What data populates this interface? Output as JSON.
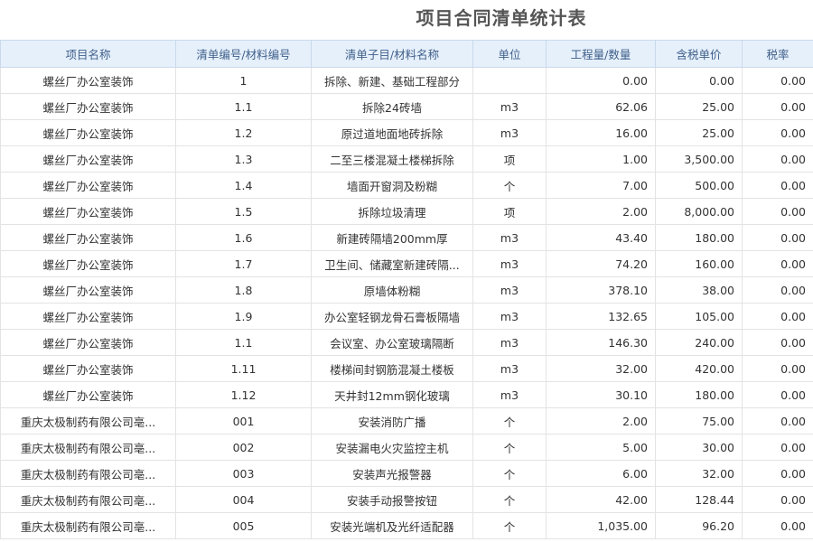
{
  "title": "项目合同清单统计表",
  "columns": [
    "项目名称",
    "清单编号/材料编号",
    "清单子目/材料名称",
    "单位",
    "工程量/数量",
    "含税单价",
    "税率"
  ],
  "rows": [
    {
      "project": "螺丝厂办公室装饰",
      "code": "1",
      "item": "拆除、新建、基础工程部分",
      "unit": "",
      "qty": "0.00",
      "price": "0.00",
      "tax": "0.00"
    },
    {
      "project": "螺丝厂办公室装饰",
      "code": "1.1",
      "item": "拆除24砖墙",
      "unit": "m3",
      "qty": "62.06",
      "price": "25.00",
      "tax": "0.00"
    },
    {
      "project": "螺丝厂办公室装饰",
      "code": "1.2",
      "item": "原过道地面地砖拆除",
      "unit": "m3",
      "qty": "16.00",
      "price": "25.00",
      "tax": "0.00"
    },
    {
      "project": "螺丝厂办公室装饰",
      "code": "1.3",
      "item": "二至三楼混凝土楼梯拆除",
      "unit": "项",
      "qty": "1.00",
      "price": "3,500.00",
      "tax": "0.00"
    },
    {
      "project": "螺丝厂办公室装饰",
      "code": "1.4",
      "item": "墙面开窗洞及粉糊",
      "unit": "个",
      "qty": "7.00",
      "price": "500.00",
      "tax": "0.00"
    },
    {
      "project": "螺丝厂办公室装饰",
      "code": "1.5",
      "item": "拆除垃圾清理",
      "unit": "项",
      "qty": "2.00",
      "price": "8,000.00",
      "tax": "0.00"
    },
    {
      "project": "螺丝厂办公室装饰",
      "code": "1.6",
      "item": "新建砖隔墙200mm厚",
      "unit": "m3",
      "qty": "43.40",
      "price": "180.00",
      "tax": "0.00"
    },
    {
      "project": "螺丝厂办公室装饰",
      "code": "1.7",
      "item": "卫生间、储藏室新建砖隔...",
      "unit": "m3",
      "qty": "74.20",
      "price": "160.00",
      "tax": "0.00"
    },
    {
      "project": "螺丝厂办公室装饰",
      "code": "1.8",
      "item": "原墙体粉糊",
      "unit": "m3",
      "qty": "378.10",
      "price": "38.00",
      "tax": "0.00"
    },
    {
      "project": "螺丝厂办公室装饰",
      "code": "1.9",
      "item": "办公室轻钢龙骨石膏板隔墙",
      "unit": "m3",
      "qty": "132.65",
      "price": "105.00",
      "tax": "0.00"
    },
    {
      "project": "螺丝厂办公室装饰",
      "code": "1.1",
      "item": "会议室、办公室玻璃隔断",
      "unit": "m3",
      "qty": "146.30",
      "price": "240.00",
      "tax": "0.00"
    },
    {
      "project": "螺丝厂办公室装饰",
      "code": "1.11",
      "item": "楼梯间封钢筋混凝土楼板",
      "unit": "m3",
      "qty": "32.00",
      "price": "420.00",
      "tax": "0.00"
    },
    {
      "project": "螺丝厂办公室装饰",
      "code": "1.12",
      "item": "天井封12mm钢化玻璃",
      "unit": "m3",
      "qty": "30.10",
      "price": "180.00",
      "tax": "0.00"
    },
    {
      "project": "重庆太极制药有限公司亳...",
      "code": "001",
      "item": "安装消防广播",
      "unit": "个",
      "qty": "2.00",
      "price": "75.00",
      "tax": "0.00"
    },
    {
      "project": "重庆太极制药有限公司亳...",
      "code": "002",
      "item": "安装漏电火灾监控主机",
      "unit": "个",
      "qty": "5.00",
      "price": "30.00",
      "tax": "0.00"
    },
    {
      "project": "重庆太极制药有限公司亳...",
      "code": "003",
      "item": "安装声光报警器",
      "unit": "个",
      "qty": "6.00",
      "price": "32.00",
      "tax": "0.00"
    },
    {
      "project": "重庆太极制药有限公司亳...",
      "code": "004",
      "item": "安装手动报警按钮",
      "unit": "个",
      "qty": "42.00",
      "price": "128.44",
      "tax": "0.00"
    },
    {
      "project": "重庆太极制药有限公司亳...",
      "code": "005",
      "item": "安装光端机及光纤适配器",
      "unit": "个",
      "qty": "1,035.00",
      "price": "96.20",
      "tax": "0.00"
    }
  ]
}
